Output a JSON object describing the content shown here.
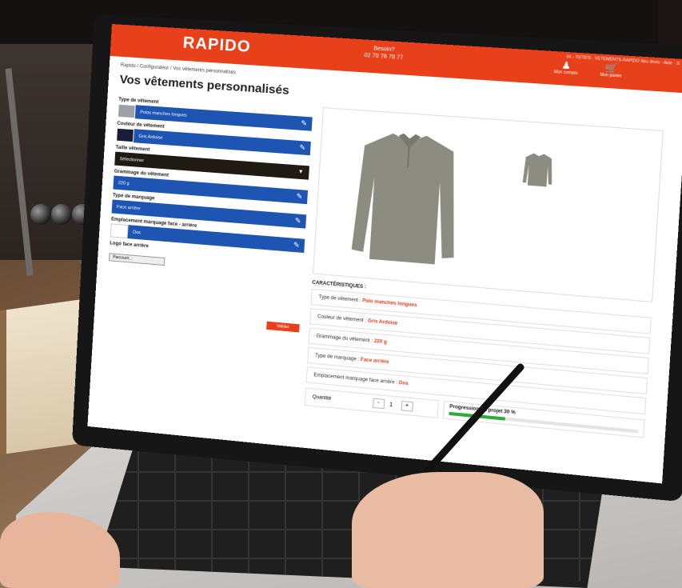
{
  "header": {
    "logo": "RAPIDO",
    "phone_label": "Besoin?",
    "phone": "02 70 78 78 77",
    "top_links": "04 - 70/7870 - VETEMENTS-RAPIDO   Nos devis  ·  Aide  ·  ☰",
    "account_label": "Mon compte",
    "cart_label": "Mon panier"
  },
  "breadcrumb": "Rapido / Configurateur / Vos vêtements personnalisés",
  "page_title": "Vos vêtements personnalisés",
  "fields": [
    {
      "label": "Type de vêtement",
      "value": "Polos manches longues"
    },
    {
      "label": "Couleur de vêtement",
      "value": "Gris Ardoise"
    },
    {
      "label": "Taille vêtement",
      "value": "Sélectionner"
    },
    {
      "label": "Grammage du vêtement",
      "value": "220 g"
    },
    {
      "label": "Type de marquage",
      "value": "Face arrière"
    },
    {
      "label": "Emplacement marquage face - arrière",
      "value": "Dos"
    }
  ],
  "logo_upload": {
    "label": "Logo face arrière",
    "button": "Parcourir..."
  },
  "submit_label": "Valider",
  "characteristics": {
    "title": "CARACTÉRISTIQUES :",
    "rows": [
      {
        "label": "Type de vêtement :",
        "value": "Polo manches longues"
      },
      {
        "label": "Couleur de vêtement :",
        "value": "Gris Ardoise"
      },
      {
        "label": "Grammage du vêtement :",
        "value": "220 g"
      },
      {
        "label": "Type de marquage :",
        "value": "Face arrière"
      },
      {
        "label": "Emplacement marquage face arrière :",
        "value": "Dos"
      }
    ]
  },
  "quantity": {
    "label": "Quantité",
    "value": "1",
    "minus": "-",
    "plus": "+"
  },
  "progress": {
    "label": "Progression du projet",
    "percent_text": "30 %",
    "fraction": 0.3
  },
  "colors": {
    "brand": "#e8401a",
    "field": "#1e55b3",
    "progress": "#2eaa3a"
  },
  "icons": {
    "edit": "edit-icon",
    "account": "user-icon",
    "cart": "cart-icon",
    "dropdown": "chevron-down-icon"
  }
}
